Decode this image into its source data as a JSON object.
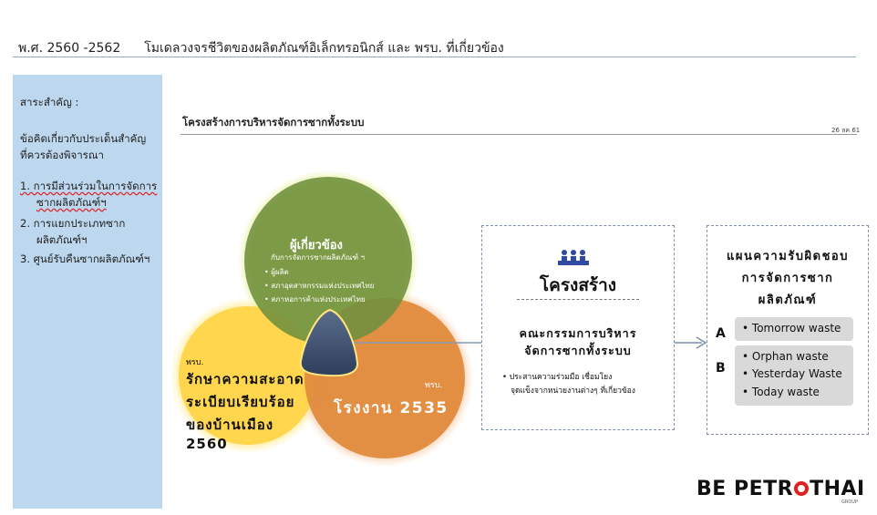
{
  "header": {
    "period": "พ.ศ. 2560 -2562",
    "title": "โมเดลวงจรชีวิตของผลิตภัณฑ์อิเล็กทรอนิกส์  และ พรบ. ที่เกี่ยวข้อง"
  },
  "sidebar": {
    "heading": "สาระสำคัญ :",
    "subheading_1": "ข้อคิดเกี่ยวกับประเด็นสำคัญ",
    "subheading_2": "ที่ควรต้องพิจารณา",
    "items": [
      {
        "line1": "1. การมีส่วนร่วมในการจัดการ",
        "line2": "ซากผลิตภัณฑ์ฯ"
      },
      {
        "line1": "2.  การแยกประเภทซาก",
        "line2": "ผลิตภัณฑ์ฯ"
      },
      {
        "line1": "3.  ศูนย์รับคืนซากผลิตภัณฑ์ฯ",
        "line2": ""
      }
    ]
  },
  "main": {
    "title": "โครงสร้างการบริหารจัดการซากทั้งระบบ",
    "date": "26 ลค 61"
  },
  "venn": {
    "green": {
      "title": "ผู้เกี่ยวข้อง",
      "subtitle": "กับการจัดการซากผลิตภัณฑ์ ฯ",
      "bullets": [
        "ผู้ผลิต",
        "สภาอุตสาหกรรมแห่งประเทศไทย",
        "สภาหอการค้าแห่งประเทศไทย"
      ],
      "color": "#6f8f3f"
    },
    "yellow": {
      "label": "พรบ.",
      "lines": [
        "รักษาความสะอาด",
        "ระเบียบเรียบร้อย",
        "ของบ้านเมือง",
        "2560"
      ],
      "color": "#ffd54a"
    },
    "orange": {
      "label": "พรบ.",
      "line": "โรงงาน 2535",
      "color": "#e08a3c"
    }
  },
  "structure_box": {
    "icon": "people-meeting-icon",
    "title": "โครงสร้าง",
    "committee_1": "คณะกรรมการบริหาร",
    "committee_2": "จัดการซากทั้งระบบ",
    "bullet_1": "ประสานความร่วมมือ เชื่อมโยง",
    "bullet_2": "จุดแข็งจากหน่วยงานต่างๆ ที่เกี่ยวข้อง"
  },
  "plan_box": {
    "title_1": "แผนความรับผิดชอบ",
    "title_2": "การจัดการซาก",
    "title_3": "ผลิตภัณฑ์",
    "group_a_label": "A",
    "group_a_items": [
      "Tomorrow waste"
    ],
    "group_b_label": "B",
    "group_b_items": [
      "Orphan waste",
      "Yesterday Waste",
      "Today waste"
    ]
  },
  "logo": {
    "text_before": "BE PETR",
    "text_after": "THAI",
    "sub": "GROUP",
    "accent": "#e02020"
  }
}
